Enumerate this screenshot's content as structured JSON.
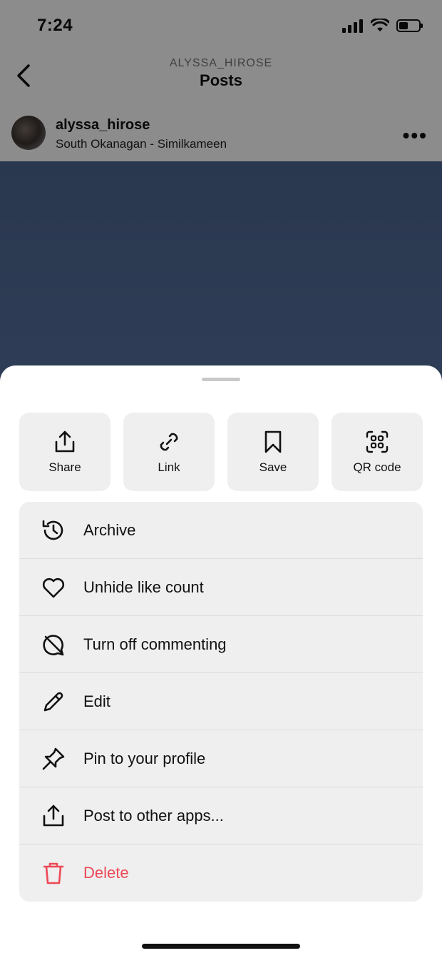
{
  "status_bar": {
    "time": "7:24"
  },
  "nav": {
    "username": "ALYSSA_HIROSE",
    "title": "Posts"
  },
  "post": {
    "username": "alyssa_hirose",
    "location": "South Okanagan - Similkameen",
    "more": "•••"
  },
  "quick_actions": [
    {
      "label": "Share",
      "icon": "share-icon"
    },
    {
      "label": "Link",
      "icon": "link-icon"
    },
    {
      "label": "Save",
      "icon": "bookmark-icon"
    },
    {
      "label": "QR code",
      "icon": "qr-code-icon"
    }
  ],
  "menu": [
    {
      "label": "Archive",
      "icon": "archive-icon"
    },
    {
      "label": "Unhide like count",
      "icon": "heart-icon"
    },
    {
      "label": "Turn off commenting",
      "icon": "comment-off-icon"
    },
    {
      "label": "Edit",
      "icon": "pencil-icon"
    },
    {
      "label": "Pin to your profile",
      "icon": "pin-icon"
    },
    {
      "label": "Post to other apps...",
      "icon": "share-icon"
    },
    {
      "label": "Delete",
      "icon": "trash-icon"
    }
  ],
  "colors": {
    "danger": "#ed4956",
    "sheet_bg": "#ffffff",
    "tile_bg": "#efefef"
  }
}
